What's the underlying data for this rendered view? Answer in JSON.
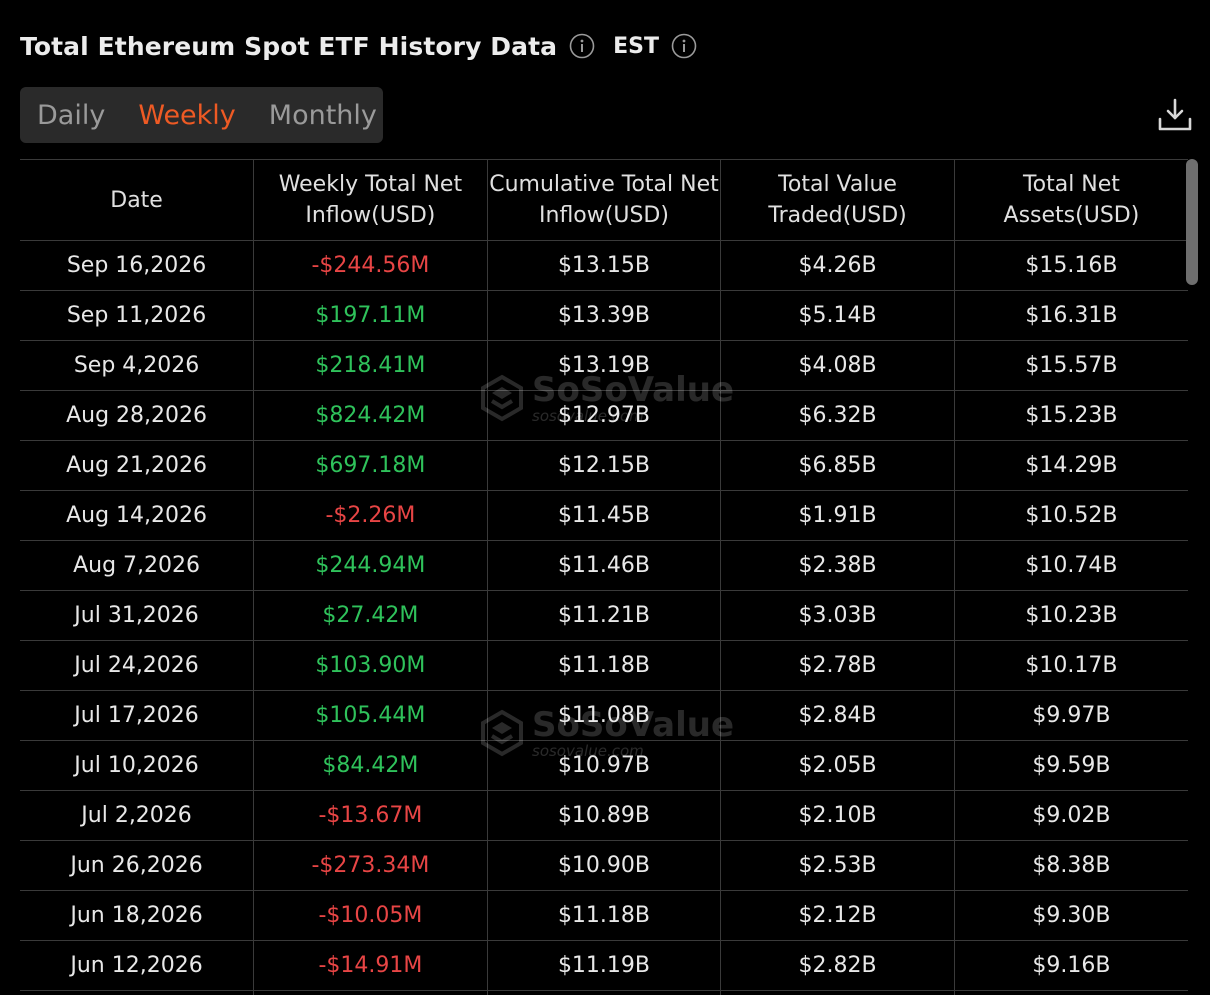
{
  "header": {
    "title": "Total Ethereum Spot ETF History Data",
    "timezone": "EST"
  },
  "tabs": {
    "items": [
      "Daily",
      "Weekly",
      "Monthly"
    ],
    "selected": "Weekly"
  },
  "icons": {
    "title_info": "info-icon",
    "timezone_info": "info-icon",
    "download": "download-icon"
  },
  "colors": {
    "accent": "#ee5a24",
    "negative": "#e84545",
    "positive": "#2fc25b",
    "background": "#000000"
  },
  "watermark": {
    "brand": "SoSoValue",
    "url": "sosovalue.com"
  },
  "table": {
    "columns": [
      "Date",
      "Weekly Total Net Inflow(USD)",
      "Cumulative Total Net Inflow(USD)",
      "Total Value Traded(USD)",
      "Total Net Assets(USD)"
    ],
    "rows": [
      {
        "date": "Sep 16,2026",
        "inflow": "-$244.56M",
        "direction": "neg",
        "cumulative": "$13.15B",
        "traded": "$4.26B",
        "assets": "$15.16B"
      },
      {
        "date": "Sep 11,2026",
        "inflow": "$197.11M",
        "direction": "pos",
        "cumulative": "$13.39B",
        "traded": "$5.14B",
        "assets": "$16.31B"
      },
      {
        "date": "Sep 4,2026",
        "inflow": "$218.41M",
        "direction": "pos",
        "cumulative": "$13.19B",
        "traded": "$4.08B",
        "assets": "$15.57B"
      },
      {
        "date": "Aug 28,2026",
        "inflow": "$824.42M",
        "direction": "pos",
        "cumulative": "$12.97B",
        "traded": "$6.32B",
        "assets": "$15.23B"
      },
      {
        "date": "Aug 21,2026",
        "inflow": "$697.18M",
        "direction": "pos",
        "cumulative": "$12.15B",
        "traded": "$6.85B",
        "assets": "$14.29B"
      },
      {
        "date": "Aug 14,2026",
        "inflow": "-$2.26M",
        "direction": "neg",
        "cumulative": "$11.45B",
        "traded": "$1.91B",
        "assets": "$10.52B"
      },
      {
        "date": "Aug 7,2026",
        "inflow": "$244.94M",
        "direction": "pos",
        "cumulative": "$11.46B",
        "traded": "$2.38B",
        "assets": "$10.74B"
      },
      {
        "date": "Jul 31,2026",
        "inflow": "$27.42M",
        "direction": "pos",
        "cumulative": "$11.21B",
        "traded": "$3.03B",
        "assets": "$10.23B"
      },
      {
        "date": "Jul 24,2026",
        "inflow": "$103.90M",
        "direction": "pos",
        "cumulative": "$11.18B",
        "traded": "$2.78B",
        "assets": "$10.17B"
      },
      {
        "date": "Jul 17,2026",
        "inflow": "$105.44M",
        "direction": "pos",
        "cumulative": "$11.08B",
        "traded": "$2.84B",
        "assets": "$9.97B"
      },
      {
        "date": "Jul 10,2026",
        "inflow": "$84.42M",
        "direction": "pos",
        "cumulative": "$10.97B",
        "traded": "$2.05B",
        "assets": "$9.59B"
      },
      {
        "date": "Jul 2,2026",
        "inflow": "-$13.67M",
        "direction": "neg",
        "cumulative": "$10.89B",
        "traded": "$2.10B",
        "assets": "$9.02B"
      },
      {
        "date": "Jun 26,2026",
        "inflow": "-$273.34M",
        "direction": "neg",
        "cumulative": "$10.90B",
        "traded": "$2.53B",
        "assets": "$8.38B"
      },
      {
        "date": "Jun 18,2026",
        "inflow": "-$10.05M",
        "direction": "neg",
        "cumulative": "$11.18B",
        "traded": "$2.12B",
        "assets": "$9.30B"
      },
      {
        "date": "Jun 12,2026",
        "inflow": "-$14.91M",
        "direction": "neg",
        "cumulative": "$11.19B",
        "traded": "$2.82B",
        "assets": "$9.16B"
      },
      {
        "date": "",
        "inflow": "",
        "direction": "neg",
        "cumulative": "",
        "traded": "",
        "assets": ""
      }
    ]
  }
}
